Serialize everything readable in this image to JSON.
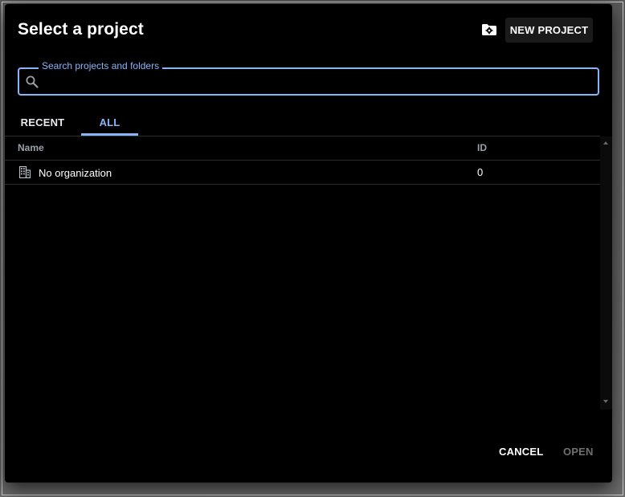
{
  "dialog": {
    "title": "Select a project",
    "new_project_label": "NEW PROJECT",
    "settings_icon": "folder-gear-icon"
  },
  "search": {
    "label": "Search projects and folders",
    "value": "",
    "placeholder": ""
  },
  "tabs": [
    {
      "label": "RECENT",
      "active": false
    },
    {
      "label": "ALL",
      "active": true
    }
  ],
  "table": {
    "columns": [
      "Name",
      "ID"
    ],
    "rows": [
      {
        "icon": "organization-building-icon",
        "name": "No organization",
        "id": "0"
      }
    ]
  },
  "footer": {
    "cancel_label": "CANCEL",
    "open_label": "OPEN"
  },
  "colors": {
    "accent": "#8ab4f8",
    "background": "#000000",
    "disabled_text": "#6f6f6f"
  }
}
